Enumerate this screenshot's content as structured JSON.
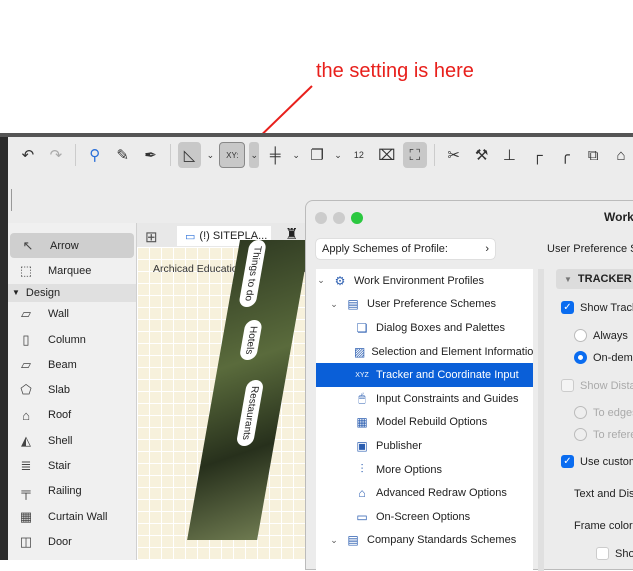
{
  "annotation": {
    "text": "the setting is here",
    "color": "#e8201c"
  },
  "toolbar": {
    "icons": [
      "undo-icon",
      "redo-icon",
      "find-select-icon",
      "pick-up-parameters-icon",
      "inject-parameters-icon",
      "guide-lines-icon",
      "tracker-icon",
      "snap-guides-icon",
      "layers-view-icon",
      "dimension-icon",
      "cross-icon",
      "edit-selection-icon",
      "split-icon",
      "adjust-icon",
      "elevate-icon",
      "intersect-icon",
      "fillet-icon",
      "resize-icon",
      "roof-icon"
    ]
  },
  "sidebar": {
    "items": [
      {
        "label": "Arrow",
        "icon": "arrow-icon"
      },
      {
        "label": "Marquee",
        "icon": "marquee-icon"
      }
    ],
    "group": "Design",
    "design_items": [
      {
        "label": "Wall",
        "icon": "wall-icon"
      },
      {
        "label": "Column",
        "icon": "column-icon"
      },
      {
        "label": "Beam",
        "icon": "beam-icon"
      },
      {
        "label": "Slab",
        "icon": "slab-icon"
      },
      {
        "label": "Roof",
        "icon": "roof-icon"
      },
      {
        "label": "Shell",
        "icon": "shell-icon"
      },
      {
        "label": "Stair",
        "icon": "stair-icon"
      },
      {
        "label": "Railing",
        "icon": "railing-icon"
      },
      {
        "label": "Curtain Wall",
        "icon": "curtain-wall-icon"
      },
      {
        "label": "Door",
        "icon": "door-icon"
      }
    ]
  },
  "view": {
    "tab": "(!) SITEPLA...",
    "watermark": "Archicad Education version, not fo",
    "map_pills": [
      "Things to do",
      "Hotels",
      "Restaurants"
    ]
  },
  "dialog": {
    "title": "Work",
    "apply_label": "Apply Schemes of Profile:",
    "right_header": "User Preference S",
    "tree": [
      {
        "label": "Work Environment Profiles",
        "level": 0,
        "expanded": true
      },
      {
        "label": "User Preference Schemes",
        "level": 1,
        "expanded": true
      },
      {
        "label": "Dialog Boxes and Palettes",
        "level": 2
      },
      {
        "label": "Selection and Element Informatio",
        "level": 2
      },
      {
        "label": "Tracker and Coordinate Input",
        "level": 2,
        "selected": true
      },
      {
        "label": "Input Constraints and Guides",
        "level": 2
      },
      {
        "label": "Model Rebuild Options",
        "level": 2
      },
      {
        "label": "Publisher",
        "level": 2
      },
      {
        "label": "More Options",
        "level": 2
      },
      {
        "label": "Advanced Redraw Options",
        "level": 2
      },
      {
        "label": "On-Screen Options",
        "level": 2
      },
      {
        "label": "Company Standards Schemes",
        "level": 1,
        "expanded": true
      }
    ],
    "section": "TRACKER A",
    "show_tracker": "Show Tracke",
    "always": "Always",
    "on_demand": "On-dema",
    "show_distance": "Show Distar",
    "to_edges": "To edges",
    "to_reference": "To refere",
    "use_custom": "Use custom",
    "text_and_dist": "Text and Dist",
    "frame_color": "Frame color:",
    "show_last": "Show"
  }
}
